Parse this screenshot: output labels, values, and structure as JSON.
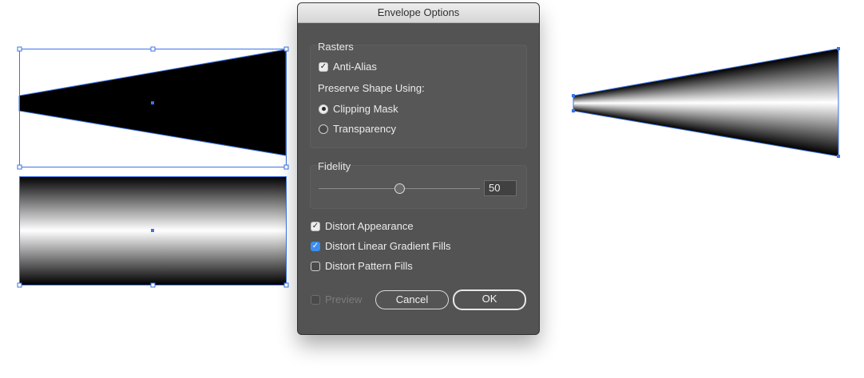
{
  "dialog": {
    "title": "Envelope Options",
    "rasters": {
      "group_title": "Rasters",
      "anti_alias": {
        "label": "Anti-Alias",
        "checked": true
      },
      "preserve_label": "Preserve Shape Using:",
      "options": [
        {
          "label": "Clipping Mask",
          "selected": true
        },
        {
          "label": "Transparency",
          "selected": false
        }
      ]
    },
    "fidelity": {
      "group_title": "Fidelity",
      "value": "50"
    },
    "distort": [
      {
        "label": "Distort Appearance",
        "checked": true
      },
      {
        "label": "Distort Linear Gradient Fills",
        "checked": true,
        "highlight": true
      },
      {
        "label": "Distort Pattern Fills",
        "checked": false
      }
    ],
    "preview": {
      "label": "Preview",
      "checked": false,
      "disabled": true
    },
    "buttons": {
      "cancel": "Cancel",
      "ok": "OK"
    }
  },
  "colors": {
    "selection": "#3a73e6",
    "dialog_bg": "#535353",
    "checkbox_accent": "#3b8ef0"
  },
  "icons": {
    "checkmark": "check-icon",
    "radio": "radio-dot-icon"
  }
}
